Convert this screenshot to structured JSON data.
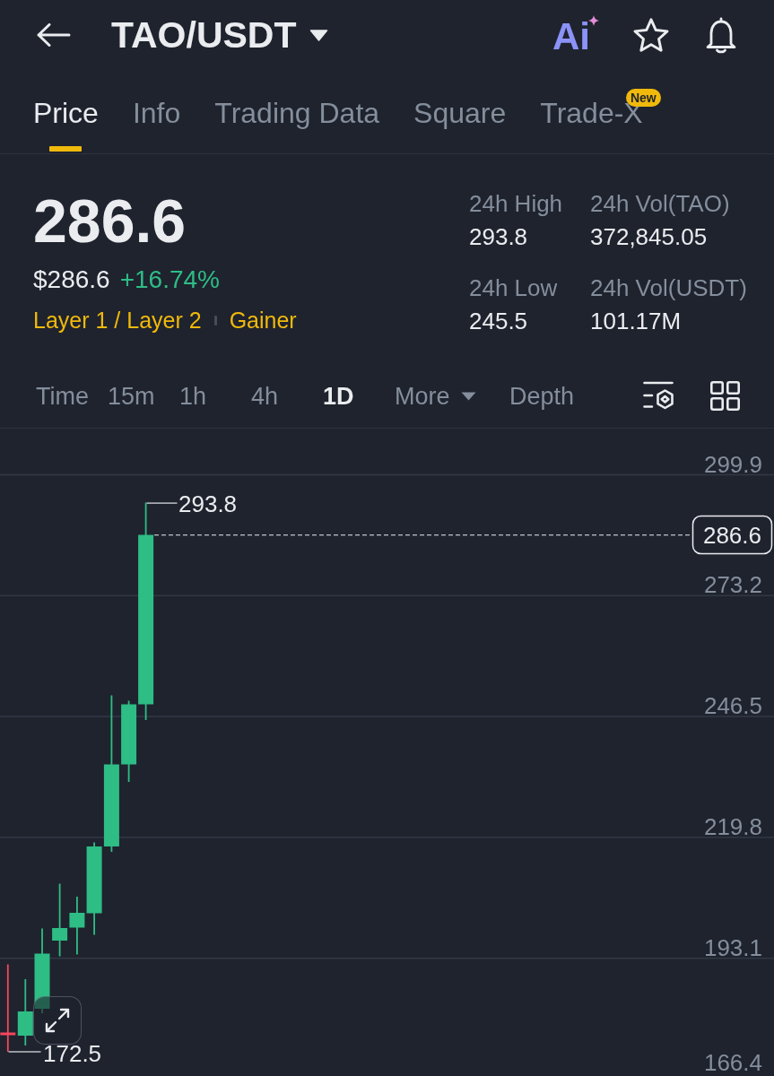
{
  "header": {
    "title": "TAO/USDT",
    "ai_label": "Ai"
  },
  "tabs": [
    {
      "label": "Price",
      "selected": true
    },
    {
      "label": "Info",
      "selected": false
    },
    {
      "label": "Trading Data",
      "selected": false
    },
    {
      "label": "Square",
      "selected": false
    },
    {
      "label": "Trade-X",
      "selected": false,
      "badge": "New"
    }
  ],
  "ticker": {
    "last_price": "286.6",
    "fiat_price": "$286.6",
    "change": "+16.74%",
    "tags": [
      "Layer 1 / Layer 2",
      "Gainer"
    ],
    "stats": [
      {
        "label": "24h High",
        "value": "293.8"
      },
      {
        "label": "24h Vol(TAO)",
        "value": "372,845.05"
      },
      {
        "label": "24h Low",
        "value": "245.5"
      },
      {
        "label": "24h Vol(USDT)",
        "value": "101.17M"
      }
    ]
  },
  "intervals": [
    {
      "label": "Time",
      "kind": "option",
      "selected": false
    },
    {
      "label": "15m",
      "kind": "option",
      "selected": false
    },
    {
      "label": "1h",
      "kind": "option",
      "selected": false
    },
    {
      "label": "4h",
      "kind": "option",
      "selected": false
    },
    {
      "label": "1D",
      "kind": "option",
      "selected": true
    },
    {
      "label": "More",
      "kind": "dropdown",
      "selected": false
    },
    {
      "label": "Depth",
      "kind": "option",
      "selected": false
    }
  ],
  "chart": {
    "price_axis": [
      "299.9",
      "273.2",
      "246.5",
      "219.8",
      "193.1",
      "166.4"
    ],
    "high_label": "293.8",
    "low_label": "172.5",
    "last_price_tag": "286.6"
  }
}
